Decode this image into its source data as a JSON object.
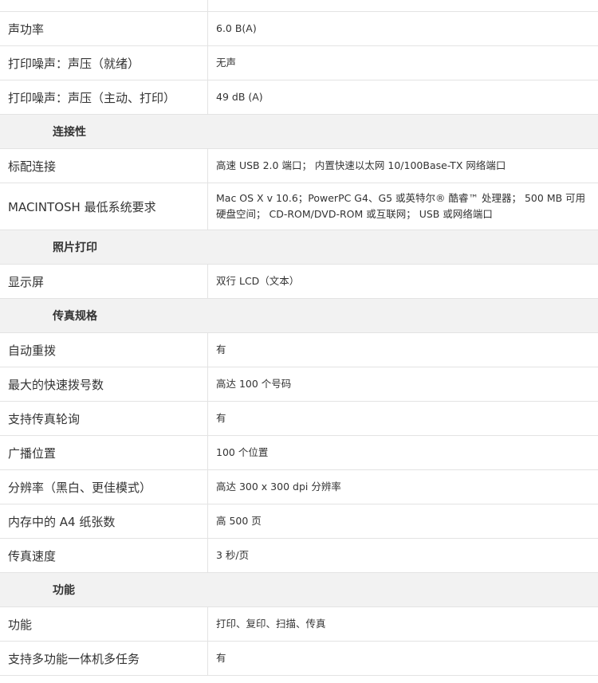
{
  "rows": [
    {
      "type": "spec",
      "label": "声功率",
      "value": "6.0 B(A)"
    },
    {
      "type": "spec",
      "label": "打印噪声：声压（就绪）",
      "value": "无声"
    },
    {
      "type": "spec",
      "label": "打印噪声：声压（主动、打印）",
      "value": "49 dB (A)"
    },
    {
      "type": "section",
      "label": "连接性"
    },
    {
      "type": "spec",
      "label": "标配连接",
      "value": "高速 USB 2.0 端口； 内置快速以太网 10/100Base-TX 网络端口"
    },
    {
      "type": "spec",
      "label": "MACINTOSH 最低系统要求",
      "value": "Mac OS X v 10.6；PowerPC G4、G5 或英特尔® 酷睿™ 处理器； 500 MB 可用硬盘空间； CD-ROM/DVD-ROM 或互联网； USB 或网络端口"
    },
    {
      "type": "section",
      "label": "照片打印"
    },
    {
      "type": "spec",
      "label": "显示屏",
      "value": "双行 LCD（文本）"
    },
    {
      "type": "section",
      "label": "传真规格"
    },
    {
      "type": "spec",
      "label": "自动重拨",
      "value": "有"
    },
    {
      "type": "spec",
      "label": "最大的快速拨号数",
      "value": "高达 100 个号码"
    },
    {
      "type": "spec",
      "label": "支持传真轮询",
      "value": "有"
    },
    {
      "type": "spec",
      "label": "广播位置",
      "value": "100 个位置"
    },
    {
      "type": "spec",
      "label": "分辨率（黑白、更佳模式）",
      "value": "高达 300 x 300 dpi 分辨率"
    },
    {
      "type": "spec",
      "label": "内存中的 A4 纸张数",
      "value": "高 500 页"
    },
    {
      "type": "spec",
      "label": "传真速度",
      "value": "3 秒/页"
    },
    {
      "type": "section",
      "label": "功能"
    },
    {
      "type": "spec",
      "label": "功能",
      "value": "打印、复印、扫描、传真"
    },
    {
      "type": "spec",
      "label": "支持多功能一体机多任务",
      "value": "有"
    }
  ]
}
